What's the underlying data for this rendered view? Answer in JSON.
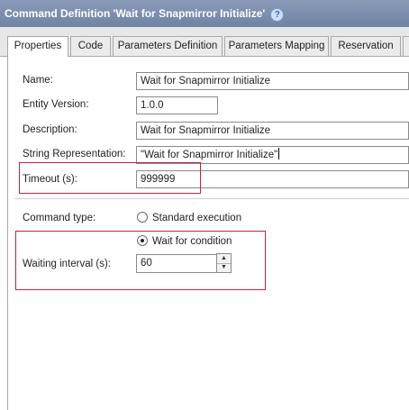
{
  "window": {
    "title": "Command Definition 'Wait for Snapmirror Initialize'",
    "help_glyph": "?"
  },
  "tabs": [
    {
      "label": "Properties",
      "active": true
    },
    {
      "label": "Code"
    },
    {
      "label": "Parameters Definition"
    },
    {
      "label": "Parameters Mapping"
    },
    {
      "label": "Reservation"
    }
  ],
  "form": {
    "name_label": "Name:",
    "name_value": "Wait for Snapmirror Initialize",
    "entity_version_label": "Entity Version:",
    "entity_version_value": "1.0.0",
    "description_label": "Description:",
    "description_value": "Wait for Snapmirror Initialize",
    "string_repr_label": "String Representation:",
    "string_repr_value": "\"Wait for Snapmirror Initialize\"",
    "timeout_label": "Timeout (s):",
    "timeout_value": "999999",
    "command_type_label": "Command type:",
    "command_type_options": [
      {
        "label": "Standard execution",
        "selected": false
      },
      {
        "label": "Wait for condition",
        "selected": true
      }
    ],
    "waiting_interval_label": "Waiting interval (s):",
    "waiting_interval_value": "60"
  },
  "colors": {
    "highlight_box": "#c0263a",
    "title_bar": "#7a8cae"
  }
}
